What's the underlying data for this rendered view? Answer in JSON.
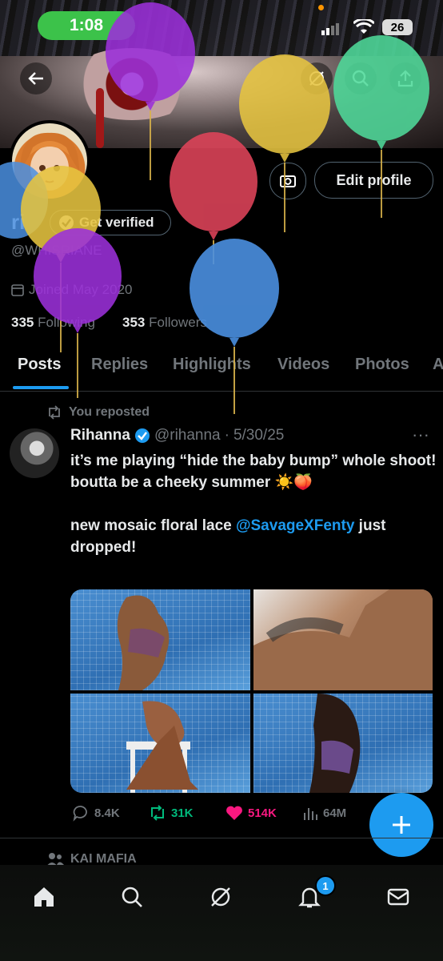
{
  "status_bar": {
    "time": "1:08",
    "battery": "26"
  },
  "profile": {
    "name_fragment": "ri",
    "verify_label": "Get verified",
    "handle": "@WHISRIANE",
    "joined": "Joined May 2020",
    "following_count": "335",
    "following_label": "Following",
    "followers_count": "353",
    "followers_label": "Followers",
    "edit_label": "Edit profile"
  },
  "tabs": [
    {
      "label": "Posts",
      "active": true
    },
    {
      "label": "Replies"
    },
    {
      "label": "Highlights"
    },
    {
      "label": "Videos"
    },
    {
      "label": "Photos"
    },
    {
      "label": "A"
    }
  ],
  "post": {
    "repost_label": "You reposted",
    "author": "Rihanna",
    "handle": "@rihanna",
    "date": "5/30/25",
    "line1": "it’s me playing “hide the baby bump” whole shoot!",
    "line2": "boutta be a cheeky summer ☀️🍑",
    "line3_pre": "new mosaic floral lace ",
    "line3_link": "@SavageXFenty",
    "line3_post": " just dropped!",
    "replies": "8.4K",
    "reposts": "31K",
    "likes": "514K",
    "views": "64M"
  },
  "next_post": {
    "context_label": "KAI MAFIA"
  },
  "nav": {
    "notification_count": "1"
  },
  "colors": {
    "accent": "#1d9bf0",
    "like": "#f91880",
    "repost": "#00ba7c",
    "status_green": "#3cc24a"
  },
  "icons": [
    "back-arrow-icon",
    "grok-icon",
    "search-icon",
    "share-icon",
    "camera-icon",
    "verified-badge-icon",
    "calendar-icon",
    "repost-icon",
    "more-icon",
    "reply-icon",
    "like-icon",
    "views-icon",
    "compose-icon",
    "home-icon",
    "notifications-icon",
    "messages-icon",
    "community-icon"
  ]
}
